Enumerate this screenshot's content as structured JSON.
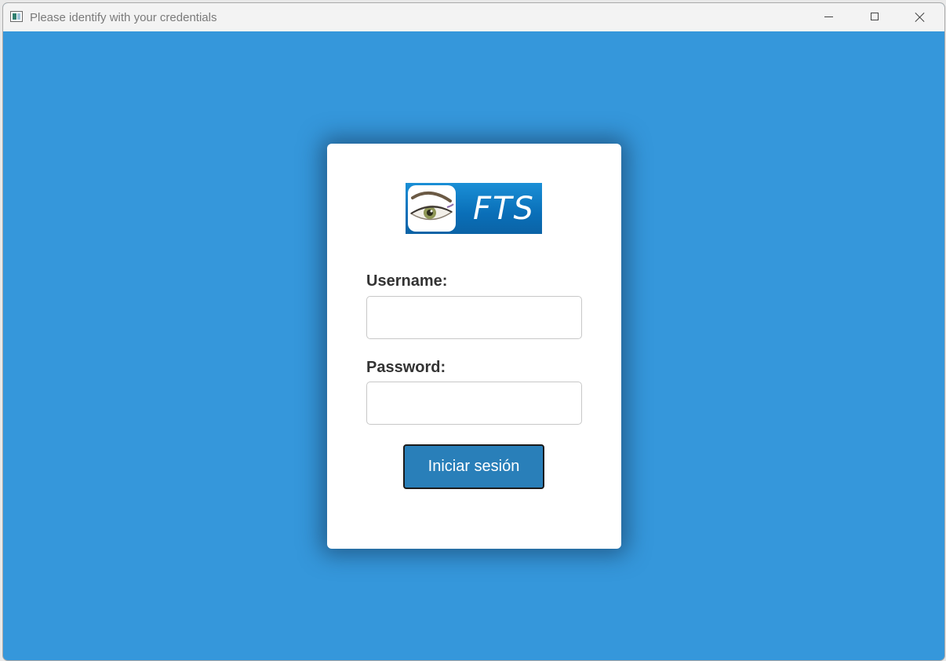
{
  "window": {
    "title": "Please identify with your credentials",
    "app_icon": "app-window-icon",
    "controls": {
      "minimize_icon": "minimize-icon",
      "maximize_icon": "maximize-icon",
      "close_icon": "close-icon"
    }
  },
  "colors": {
    "background": "#3597db",
    "card": "#ffffff",
    "button": "#297fb9",
    "label_text": "#333333"
  },
  "login": {
    "logo_text": "FTS",
    "username_label": "Username:",
    "username_value": "",
    "password_label": "Password:",
    "password_value": "",
    "submit_label": "Iniciar sesión"
  }
}
